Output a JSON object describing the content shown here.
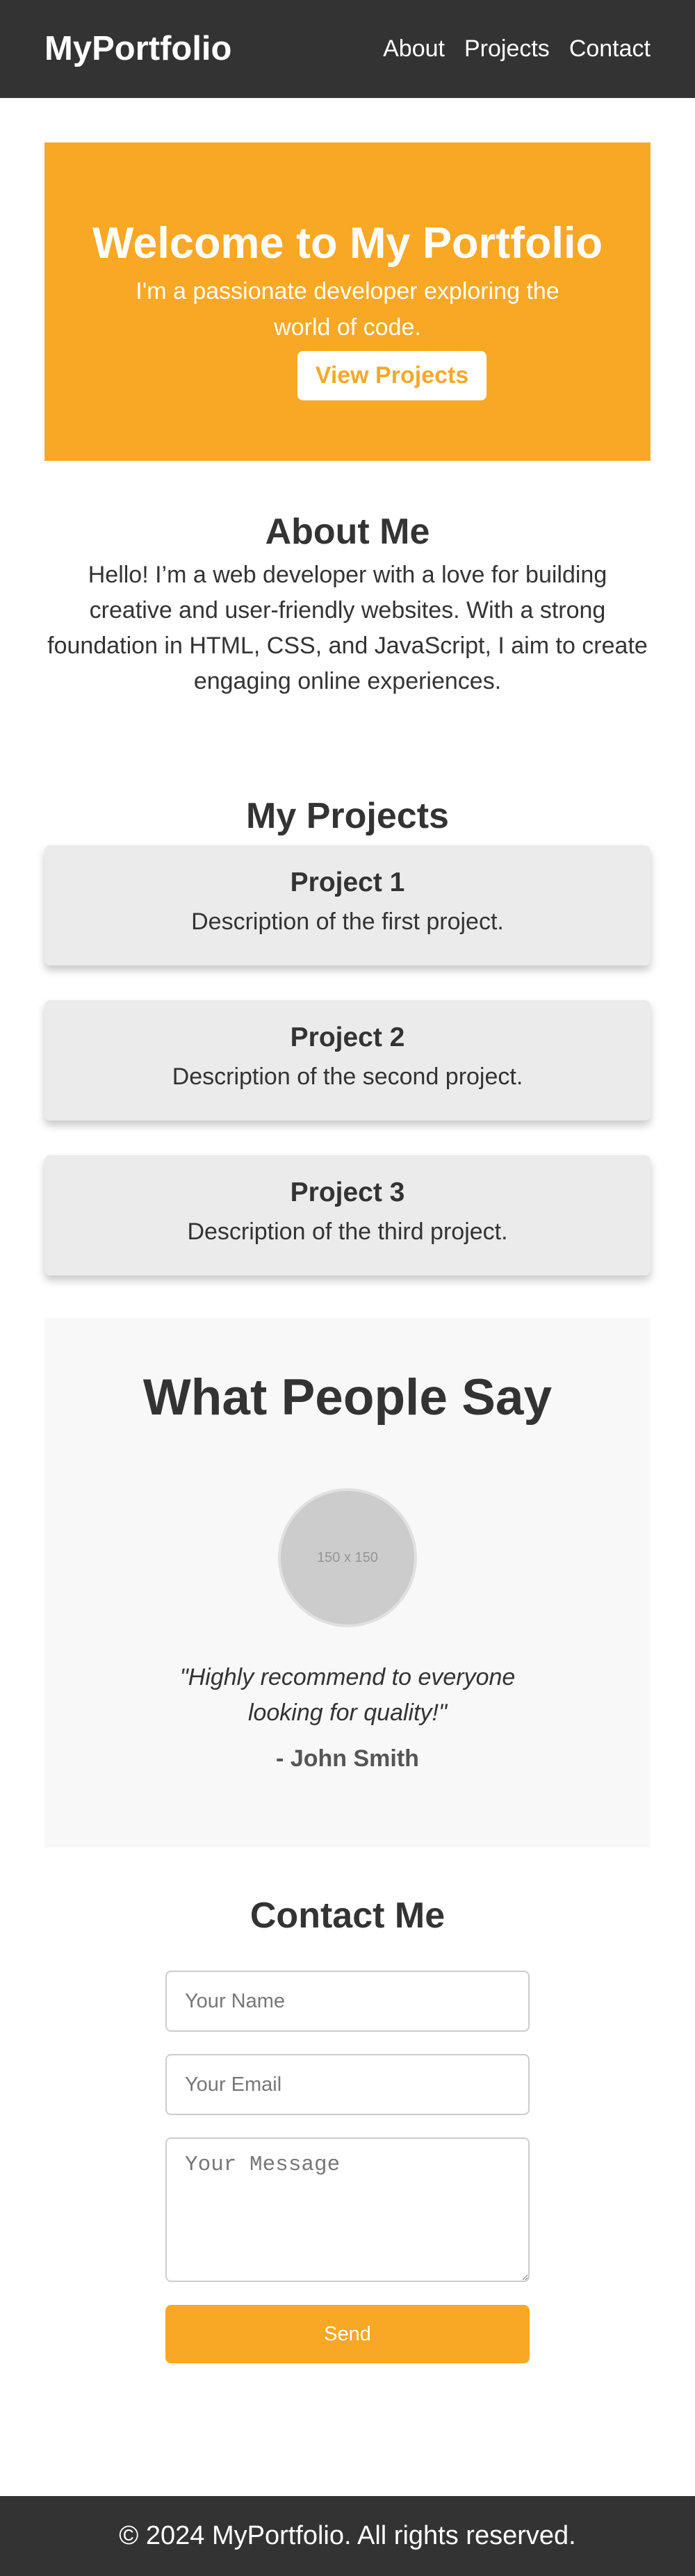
{
  "header": {
    "brand": "MyPortfolio",
    "nav": [
      "About",
      "Projects",
      "Contact"
    ]
  },
  "hero": {
    "title": "Welcome to My Portfolio",
    "subtitle": "I'm a passionate developer exploring the world of code.",
    "button_label": "View Projects",
    "background_color": "#f9a826"
  },
  "about": {
    "title": "About Me",
    "text": "Hello! I’m a web developer with a love for building creative and user-friendly websites. With a strong foundation in HTML, CSS, and JavaScript, I aim to create engaging online experiences."
  },
  "projects": {
    "title": "My Projects",
    "items": [
      {
        "title": "Project 1",
        "description": "Description of the first project."
      },
      {
        "title": "Project 2",
        "description": "Description of the second project."
      },
      {
        "title": "Project 3",
        "description": "Description of the third project."
      }
    ]
  },
  "testimonials": {
    "title": "What People Say",
    "avatar_text": "150 x 150",
    "quote": "\"Highly recommend to everyone looking for quality!\"",
    "author": "- John Smith"
  },
  "contact": {
    "title": "Contact Me",
    "name_placeholder": "Your Name",
    "email_placeholder": "Your Email",
    "message_placeholder": "Your Message",
    "send_label": "Send"
  },
  "footer": {
    "text": "© 2024 MyPortfolio. All rights reserved."
  },
  "colors": {
    "header": "#333333",
    "accent": "#f9a826",
    "card": "#ebebeb"
  }
}
